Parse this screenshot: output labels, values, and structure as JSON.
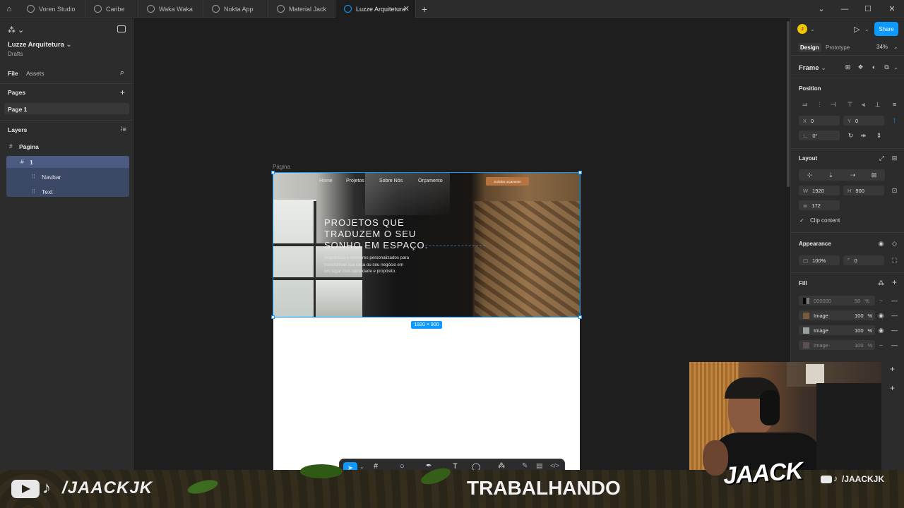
{
  "tabs": [
    {
      "label": "Voren Studio"
    },
    {
      "label": "Caribe"
    },
    {
      "label": "Waka Waka"
    },
    {
      "label": "Nokta App"
    },
    {
      "label": "Material Jack"
    },
    {
      "label": "Luzze Arquitetura"
    }
  ],
  "file": {
    "title": "Luzze Arquitetura",
    "location": "Drafts"
  },
  "leftpanel": {
    "tab_file": "File",
    "tab_assets": "Assets",
    "pages_header": "Pages",
    "page_1": "Page 1",
    "layers_header": "Layers",
    "layers": [
      {
        "name": "Página"
      },
      {
        "name": "1"
      },
      {
        "name": "Navbar"
      },
      {
        "name": "Text"
      }
    ]
  },
  "canvas": {
    "frame_label": "Página",
    "size_badge": "1920 × 900",
    "hero": {
      "nav": [
        "Home",
        "Projetos",
        "Sobre Nós",
        "Orçamento"
      ],
      "cta": "Solicitar orçamento",
      "headline": [
        "PROJETOS QUE",
        "TRADUZEM O SEU",
        "SONHO EM ESPAÇO."
      ],
      "body": [
        "Arquitetura e interiores personalizados para",
        "transformar sua casa ou seu negócio em",
        "um lugar com identidade e propósito."
      ]
    }
  },
  "rightpanel": {
    "avatar": "J",
    "share": "Share",
    "tab_design": "Design",
    "tab_prototype": "Prototype",
    "zoom": "34%",
    "frame_type": "Frame",
    "position_header": "Position",
    "x_label": "X",
    "x_value": "0",
    "y_label": "Y",
    "y_value": "0",
    "rotation": "0°",
    "layout_header": "Layout",
    "w_label": "W",
    "w_value": "1920",
    "h_label": "H",
    "h_value": "900",
    "gap_value": "172",
    "clip_content": "Clip content",
    "appearance_header": "Appearance",
    "opacity": "100%",
    "radius": "0",
    "fill_header": "Fill",
    "fills": [
      {
        "name": "000000",
        "opacity": "50",
        "unit": "%"
      },
      {
        "name": "Image",
        "opacity": "100",
        "unit": "%"
      },
      {
        "name": "Image",
        "opacity": "100",
        "unit": "%"
      },
      {
        "name": "Image",
        "opacity": "100",
        "unit": "%"
      }
    ]
  },
  "overlay": {
    "handle_left": "/JAACKJK",
    "status": "TRABALHANDO",
    "logo": "JAACK",
    "handle_right": "/JAACKJK"
  },
  "colors": {
    "accent": "#0d99ff",
    "selection": "#3b4866",
    "cta": "#b5743f"
  }
}
